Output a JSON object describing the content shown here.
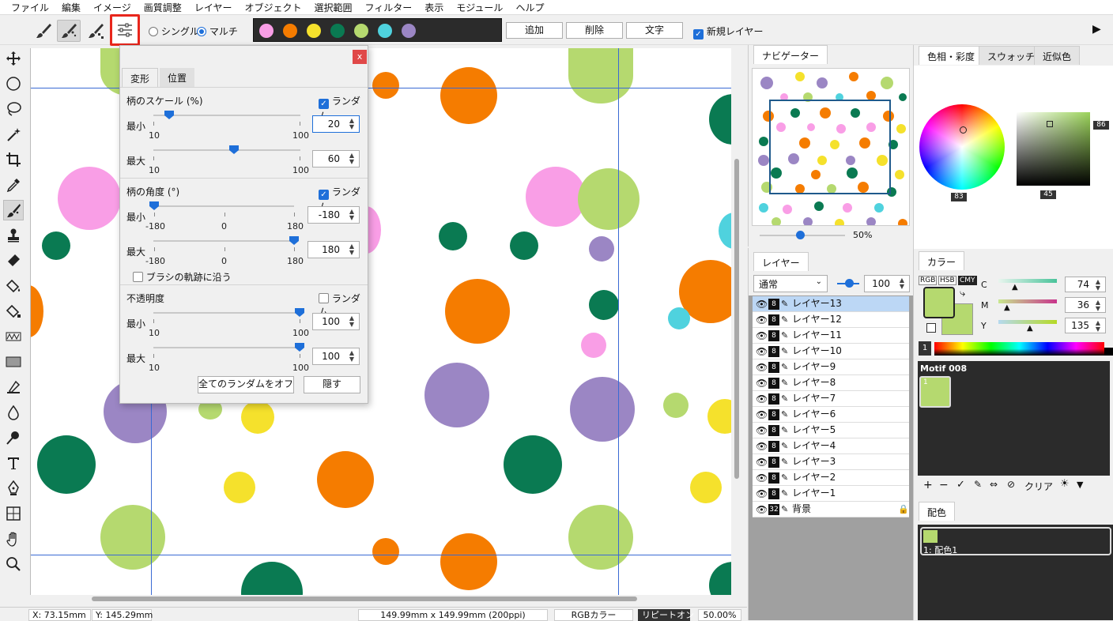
{
  "menubar": [
    "ファイル",
    "編集",
    "イメージ",
    "画質調整",
    "レイヤー",
    "オブジェクト",
    "選択範囲",
    "フィルター",
    "表示",
    "モジュール",
    "ヘルプ"
  ],
  "toolbar": {
    "single_label": "シングル",
    "multi_label": "マルチ",
    "palette_colors": [
      "#f99ee6",
      "#f57c00",
      "#f5e12c",
      "#0a7a52",
      "#b5d96f",
      "#4fd2de",
      "#9b86c4"
    ],
    "add_label": "追加",
    "delete_label": "削除",
    "text_label": "文字",
    "new_layer_label": "新規レイヤー"
  },
  "dialog": {
    "tab_transform": "変形",
    "tab_position": "位置",
    "close": "x",
    "random_label": "ランダム",
    "scale": {
      "title": "柄のスケール (%)",
      "random": true,
      "min_label": "最小",
      "max_label": "最大",
      "range_min": "10",
      "range_max": "100",
      "min_value": "20",
      "max_value": "60",
      "min_frac": 0.11,
      "max_frac": 0.56
    },
    "angle": {
      "title": "柄の角度 (°)",
      "random": true,
      "min_label": "最小",
      "max_label": "最大",
      "range_min": "-180",
      "range_mid": "0",
      "range_max": "180",
      "min_value": "-180",
      "max_value": "180",
      "min_frac": 0.0,
      "max_frac": 1.0
    },
    "follow_path": "ブラシの軌跡に沿う",
    "opacity": {
      "title": "不透明度",
      "random": false,
      "min_label": "最小",
      "max_label": "最大",
      "range_min": "10",
      "range_max": "100",
      "min_value": "100",
      "max_value": "100",
      "min_frac": 1.0,
      "max_frac": 1.0
    },
    "all_random_off": "全てのランダムをオフ",
    "hide": "隠す"
  },
  "statusbar": {
    "x": "X:   73.15mm",
    "y": "Y:  145.29mm",
    "size": "149.99mm x 149.99mm (200ppi)",
    "color_mode": "RGBカラー",
    "repeat": "リピートオン",
    "zoom": "50.00%"
  },
  "navigator": {
    "tab": "ナビゲーター",
    "zoom": "50%",
    "zoom_frac": 0.45
  },
  "layers": {
    "tab": "レイヤー",
    "blend": "通常",
    "opacity": "100",
    "items": [
      "レイヤー13",
      "レイヤー12",
      "レイヤー11",
      "レイヤー10",
      "レイヤー9",
      "レイヤー8",
      "レイヤー7",
      "レイヤー6",
      "レイヤー5",
      "レイヤー4",
      "レイヤー3",
      "レイヤー2",
      "レイヤー1"
    ],
    "background": "背景",
    "depth_label": "8",
    "bg_depth_label": "32"
  },
  "color_panel": {
    "tabs": [
      "色相・彩度",
      "スウォッチ",
      "近似色"
    ],
    "hue_value": "83",
    "sat_value": "45",
    "bright_value": "86"
  },
  "color_values": {
    "tab": "カラー",
    "modes": [
      "RGB",
      "HSB",
      "CMY"
    ],
    "c_label": "C",
    "c_value": "74",
    "m_label": "M",
    "m_value": "36",
    "y_label": "Y",
    "y_value": "135",
    "main_color": "#b5d96f"
  },
  "motif": {
    "title": "Motif 008",
    "item_num": "1",
    "clear": "クリア"
  },
  "haishoku": {
    "tab": "配色",
    "item": "1: 配色1"
  },
  "spectrum_label": "1"
}
